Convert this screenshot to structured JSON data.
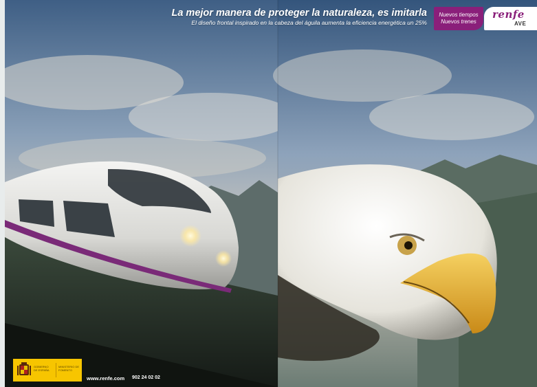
{
  "headline": "La mejor manera de proteger la naturaleza, es imitarla",
  "subheadline": "El diseño frontal inspirado en la cabeza del águila aumenta la eficiencia energética un 25%",
  "badge": {
    "line1": "Nuevos tiempos",
    "line2": "Nuevos trenes",
    "color": "#8a1f7a"
  },
  "logo": {
    "brand": "renfe",
    "sub": "AVE"
  },
  "government": {
    "label_left": "GOBIERNO DE ESPAÑA",
    "label_right": "MINISTERIO DE FOMENTO",
    "color": "#f7c500"
  },
  "footer": {
    "website": "www.renfe.com",
    "phone": "902 24 02 02"
  },
  "images": {
    "left": "high-speed train",
    "right": "bald eagle head"
  }
}
